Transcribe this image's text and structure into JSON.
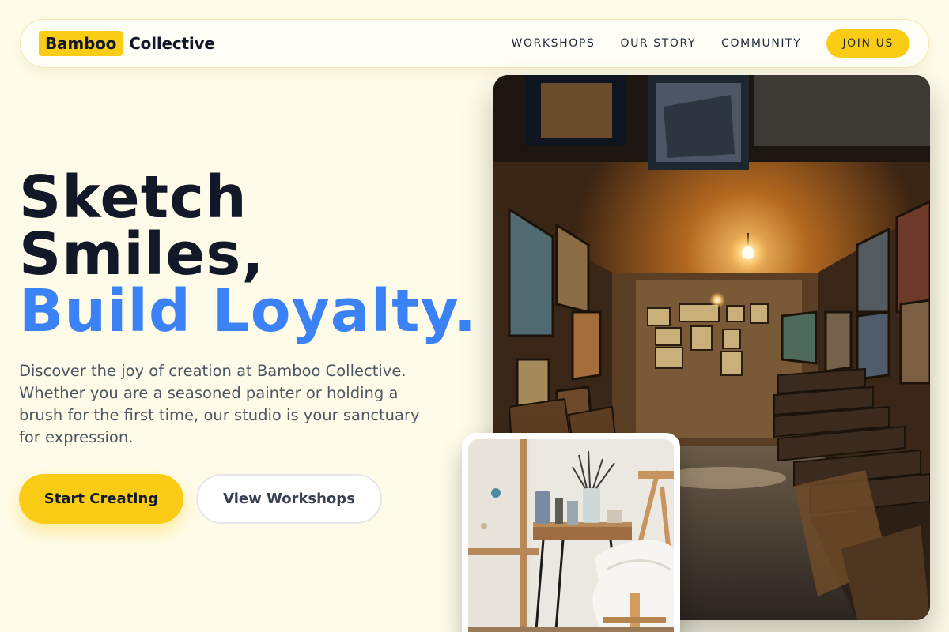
{
  "brand": {
    "logo_mark": "Bamboo",
    "logo_text": "Collective",
    "accent_color": "#facc15",
    "highlight_color": "#3b82f6"
  },
  "nav": {
    "links": [
      "WORKSHOPS",
      "OUR STORY",
      "COMMUNITY"
    ],
    "cta": "JOIN US"
  },
  "hero": {
    "headline_line1": "Sketch",
    "headline_line2": "Smiles,",
    "headline_accent": "Build Loyalty.",
    "description": "Discover the joy of creation at Bamboo Collective. Whether you are a seasoned painter or holding a brush for the first time, our studio is your sanctuary for expression.",
    "primary_button": "Start Creating",
    "secondary_button": "View Workshops"
  },
  "images": {
    "main": "art-gallery-corridor-photo",
    "inset": "painter-studio-desk-photo"
  }
}
